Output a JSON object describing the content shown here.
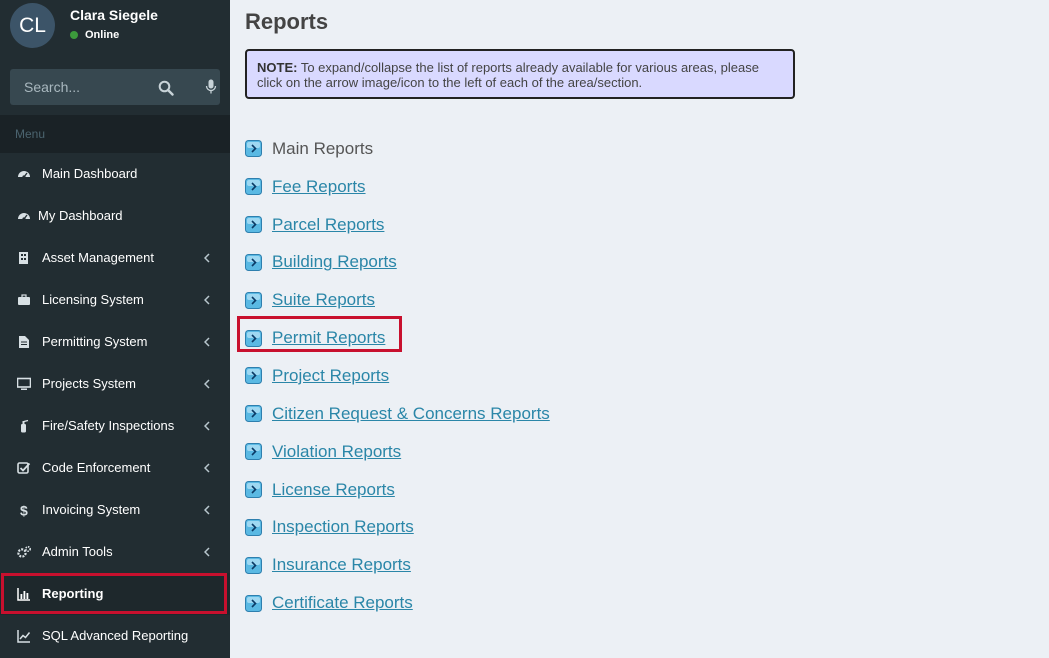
{
  "user": {
    "initials": "CL",
    "name": "Clara Siegele",
    "status": "Online"
  },
  "search": {
    "placeholder": "Search..."
  },
  "menu_header": "Menu",
  "menu": [
    {
      "label": "Main Dashboard",
      "icon": "dashboard-icon",
      "chevron": false
    },
    {
      "label": "My Dashboard",
      "icon": "dashboard-icon",
      "chevron": false
    },
    {
      "label": "Asset Management",
      "icon": "building-icon",
      "chevron": true
    },
    {
      "label": "Licensing System",
      "icon": "briefcase-icon",
      "chevron": true
    },
    {
      "label": "Permitting System",
      "icon": "document-icon",
      "chevron": true
    },
    {
      "label": "Projects System",
      "icon": "monitor-icon",
      "chevron": true
    },
    {
      "label": "Fire/Safety Inspections",
      "icon": "fire-extinguisher-icon",
      "chevron": true
    },
    {
      "label": "Code Enforcement",
      "icon": "checkbox-icon",
      "chevron": true
    },
    {
      "label": "Invoicing System",
      "icon": "dollar-icon",
      "chevron": true
    },
    {
      "label": "Admin Tools",
      "icon": "gears-icon",
      "chevron": true
    },
    {
      "label": "Reporting",
      "icon": "bar-chart-icon",
      "chevron": false,
      "active": true
    },
    {
      "label": "SQL Advanced Reporting",
      "icon": "line-chart-icon",
      "chevron": false
    }
  ],
  "page": {
    "title": "Reports"
  },
  "note": {
    "label": "NOTE:",
    "text": "To expand/collapse the list of reports already available for various areas, please click on the arrow image/icon to the left of each of the area/section."
  },
  "reports": [
    {
      "label": "Main Reports",
      "link": false
    },
    {
      "label": "Fee Reports",
      "link": true
    },
    {
      "label": "Parcel Reports",
      "link": true
    },
    {
      "label": "Building Reports",
      "link": true
    },
    {
      "label": "Suite Reports",
      "link": true
    },
    {
      "label": "Permit Reports",
      "link": true
    },
    {
      "label": "Project Reports",
      "link": true
    },
    {
      "label": "Citizen Request & Concerns Reports",
      "link": true
    },
    {
      "label": "Violation Reports",
      "link": true
    },
    {
      "label": "License Reports",
      "link": true
    },
    {
      "label": "Inspection Reports",
      "link": true
    },
    {
      "label": "Insurance Reports",
      "link": true
    },
    {
      "label": "Certificate Reports",
      "link": true
    }
  ]
}
